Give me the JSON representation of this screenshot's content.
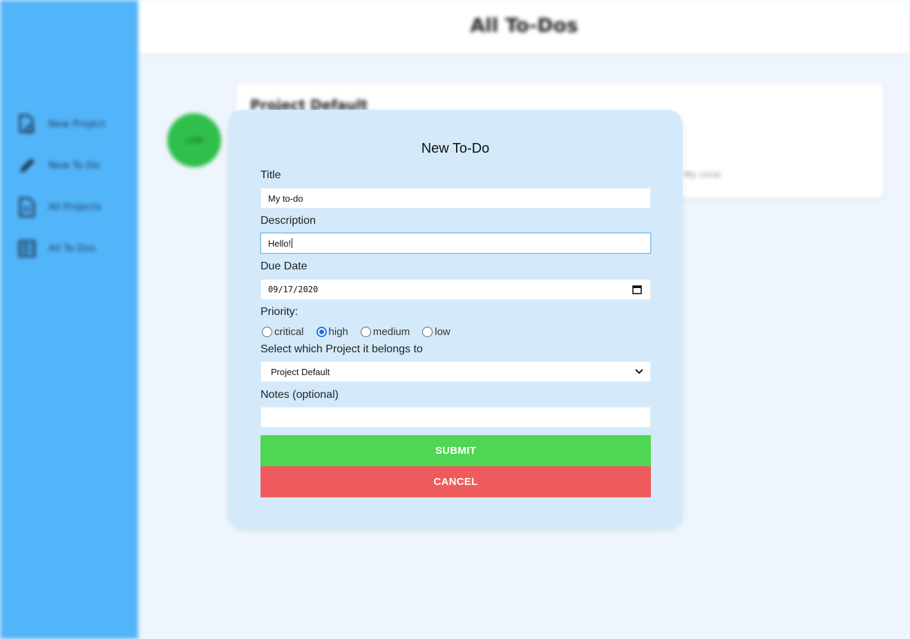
{
  "background": {
    "page_title": "All To-Dos",
    "nav": [
      {
        "label": "New Project",
        "icon": "new-project-icon"
      },
      {
        "label": "New To-Do",
        "icon": "pencil-icon"
      },
      {
        "label": "All Projects",
        "icon": "document-icon"
      },
      {
        "label": "All To-Dos",
        "icon": "grid-icon"
      }
    ],
    "status_badge": "LOW",
    "project_title": "Project Default",
    "card_faint_text": "My circle"
  },
  "modal": {
    "title": "New To-Do",
    "title_label": "Title",
    "title_value": "My to-do",
    "description_label": "Description",
    "description_value": "Hello!",
    "due_date_label": "Due Date",
    "due_date_value": "09/17/2020",
    "priority_label": "Priority:",
    "priority_options": [
      "critical",
      "high",
      "medium",
      "low"
    ],
    "priority_selected": "high",
    "project_label": "Select which Project it belongs to",
    "project_selected": "Project Default",
    "notes_label": "Notes (optional)",
    "notes_value": "",
    "submit_label": "SUBMIT",
    "cancel_label": "CANCEL"
  },
  "colors": {
    "sidebar": "#53b5f9",
    "modal_bg": "#d4eafb",
    "submit": "#4fd653",
    "cancel": "#ef5b5c",
    "radio_accent": "#1a73e8"
  }
}
